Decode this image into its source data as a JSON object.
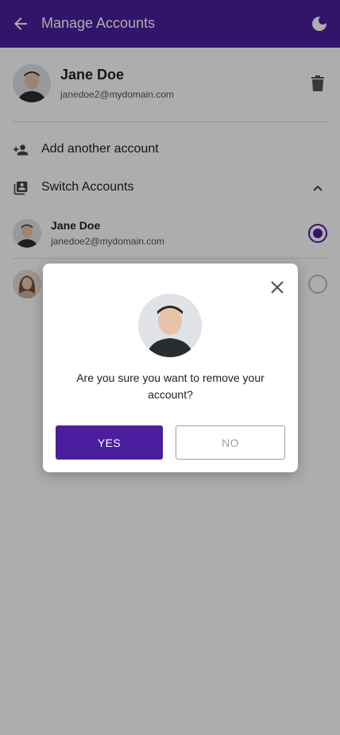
{
  "colors": {
    "primary": "#4a1e9e",
    "appbar_text": "#ffffff"
  },
  "appbar": {
    "title": "Manage Accounts",
    "back_icon": "arrow-back-icon",
    "theme_icon": "moon-icon"
  },
  "current_account": {
    "name": "Jane Doe",
    "email": "janedoe2@mydomain.com",
    "delete_icon": "trash-icon"
  },
  "menu": {
    "add_account": "Add another account",
    "switch_accounts": "Switch Accounts"
  },
  "accounts": [
    {
      "name": "Jane Doe",
      "email": "janedoe2@mydomain.com",
      "selected": true
    },
    {
      "name": "",
      "email": "",
      "selected": false
    }
  ],
  "dialog": {
    "message": "Are you sure you want to remove your account?",
    "yes_label": "YES",
    "no_label": "NO",
    "close_icon": "close-icon"
  }
}
